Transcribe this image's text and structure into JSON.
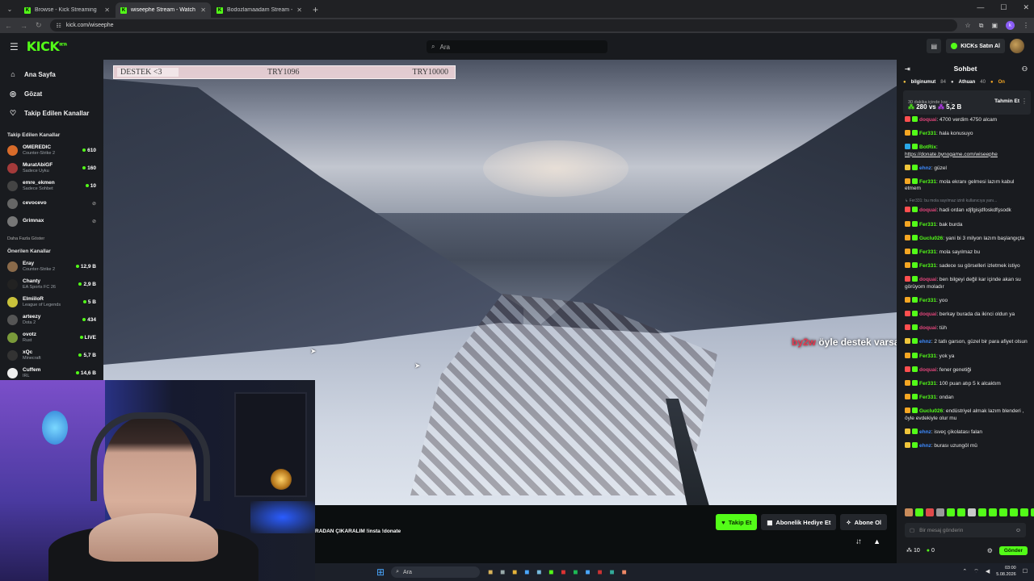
{
  "browser": {
    "tabs": [
      {
        "title": "Browse - Kick Streaming",
        "active": false
      },
      {
        "title": "wiseephe Stream - Watch Live o",
        "active": true
      },
      {
        "title": "Bodozlamaadam Stream - Watc",
        "active": false
      }
    ],
    "url": "kick.com/wiseephe"
  },
  "header": {
    "logo": "KICK",
    "logo_sup": "BETA",
    "search_placeholder": "Ara",
    "buy_kicks": "KICKs Satın Al"
  },
  "sidebar": {
    "nav": [
      {
        "icon": "home-icon",
        "glyph": "⌂",
        "label": "Ana Sayfa"
      },
      {
        "icon": "compass-icon",
        "glyph": "◎",
        "label": "Gözat"
      },
      {
        "icon": "heart-icon",
        "glyph": "♡",
        "label": "Takip Edilen Kanallar"
      }
    ],
    "followed_title": "Takip Edilen Kanallar",
    "followed": [
      {
        "name": "OMEREDIC",
        "game": "Counter-Strike 2",
        "viewers": "610",
        "color": "#d86b2a"
      },
      {
        "name": "MuratAbiGF",
        "game": "Sadece Uyku",
        "viewers": "160",
        "color": "#a33a3a"
      },
      {
        "name": "emre_ekmen",
        "game": "Sadece Sohbet",
        "viewers": "10",
        "color": "#444"
      },
      {
        "name": "cevocevo",
        "game": "",
        "viewers": "",
        "color": "#666"
      },
      {
        "name": "Grimnax",
        "game": "",
        "viewers": "",
        "color": "#777"
      }
    ],
    "more_label": "Daha Fazla Göster",
    "recommended_title": "Önerilen Kanallar",
    "recommended": [
      {
        "name": "Eray",
        "game": "Counter-Strike 2",
        "viewers": "12,9 B",
        "color": "#8a6a4a"
      },
      {
        "name": "Chanty",
        "game": "EA Sports FC 26",
        "viewers": "2,9 B",
        "color": "#222"
      },
      {
        "name": "ElmiiloR",
        "game": "League of Legends",
        "viewers": "5 B",
        "color": "#c9c23b"
      },
      {
        "name": "arteezy",
        "game": "Dota 2",
        "viewers": "434",
        "color": "#555"
      },
      {
        "name": "ovotz",
        "game": "Rust",
        "viewers": "LIVE",
        "color": "#7a9a3a"
      },
      {
        "name": "xQc",
        "game": "Minecraft",
        "viewers": "5,7 B",
        "color": "#333"
      },
      {
        "name": "Cuffem",
        "game": "IRL",
        "viewers": "14,6 B",
        "color": "#eee"
      }
    ]
  },
  "video": {
    "donation_label": "DESTEK <3",
    "donation_current": "TRY1096",
    "donation_goal": "TRY10000",
    "overlay_user": "by2w",
    "overlay_text": " öyle destek varsa o desteğin amk"
  },
  "below": {
    "stream_title": "RADAN ÇIKARALIM !insta !donate",
    "follow": "Takip Et",
    "gift": "Abonelik Hediye Et",
    "subscribe": "Abone Ol"
  },
  "chat": {
    "title": "Sohbet",
    "top": [
      {
        "name": "bilginumut",
        "count": "84"
      },
      {
        "name": "Athuan",
        "count": "40"
      },
      {
        "name": "On",
        "count": ""
      }
    ],
    "prediction_q": "30 dakika içinde kaç ...",
    "prediction_green": "280",
    "prediction_mid": " vs ",
    "prediction_purple": "5,2 B",
    "prediction_btn": "Tahmin Et",
    "messages": [
      {
        "user": "doquai",
        "ucolor": "#e0457a",
        "text": ": 4700 verdim 4750 alcam",
        "badge": "#ff4f4f"
      },
      {
        "user": "Fer331",
        "ucolor": "#53fc18",
        "text": ": hala konusuyo",
        "badge": "#f5a623"
      },
      {
        "user": "BotRix",
        "ucolor": "#53fc18",
        "text": ":",
        "badge": "#2aa7e8",
        "link": "https://donate.bynogame.com/wiseephe"
      },
      {
        "user": "ehnz",
        "ucolor": "#3e8bff",
        "text": ": güzel",
        "badge": "#f0c53b"
      },
      {
        "user": "Fer331",
        "ucolor": "#53fc18",
        "text": ": mola ekranı gelmesi lazım kabul etmem",
        "badge": "#f5a623"
      },
      {
        "user": "",
        "ucolor": "#777",
        "text": "↳ Fer331: bu mola sayılmaz izinli kullanıcıya yanı...",
        "badge": "",
        "small": true
      },
      {
        "user": "doquai",
        "ucolor": "#e0457a",
        "text": ": hadi ordan ıdjfgisjdfoskdfşsodk",
        "badge": "#ff4f4f"
      },
      {
        "user": "Fer331",
        "ucolor": "#53fc18",
        "text": ": bak burda",
        "badge": "#f5a623"
      },
      {
        "user": "Guclu026",
        "ucolor": "#53fc18",
        "text": ": yani bi 3 milyon lazım başlangıçta",
        "badge": "#f5a623"
      },
      {
        "user": "Fer331",
        "ucolor": "#53fc18",
        "text": ": mola sayılmaz bu",
        "badge": "#f5a623"
      },
      {
        "user": "Fer331",
        "ucolor": "#53fc18",
        "text": ": sadece su görselleri izletmek istiyo",
        "badge": "#f5a623"
      },
      {
        "user": "doquai",
        "ucolor": "#e0457a",
        "text": ": ben bilgeyi değil kar içinde akan su görüyom moladır",
        "badge": "#ff4f4f"
      },
      {
        "user": "Fer331",
        "ucolor": "#53fc18",
        "text": ": yoo",
        "badge": "#f5a623"
      },
      {
        "user": "doquai",
        "ucolor": "#e0457a",
        "text": ": berkay burada da ikinci oldun ya",
        "badge": "#ff4f4f"
      },
      {
        "user": "doquai",
        "ucolor": "#e0457a",
        "text": ": tüh",
        "badge": "#ff4f4f"
      },
      {
        "user": "ehnz",
        "ucolor": "#3e8bff",
        "text": ": 2 tatlı garson, güzel bir para afiyet olsun",
        "badge": "#f0c53b"
      },
      {
        "user": "Fer331",
        "ucolor": "#53fc18",
        "text": ": yok ya",
        "badge": "#f5a623"
      },
      {
        "user": "doquai",
        "ucolor": "#e0457a",
        "text": ": fener genetiği",
        "badge": "#ff4f4f"
      },
      {
        "user": "Fer331",
        "ucolor": "#53fc18",
        "text": ": 100 puan atıp 5 k alcaktım",
        "badge": "#f5a623"
      },
      {
        "user": "Fer331",
        "ucolor": "#53fc18",
        "text": ": ondan",
        "badge": "#f5a623"
      },
      {
        "user": "Guclu026",
        "ucolor": "#53fc18",
        "text": ": endüstriyel almak lazım blenderi , öyle evdekiyle olur mu",
        "badge": "#f5a623"
      },
      {
        "user": "ehnz",
        "ucolor": "#3e8bff",
        "text": ": isveç çikolatası falan",
        "badge": "#f0c53b"
      },
      {
        "user": "ehnz",
        "ucolor": "#3e8bff",
        "text": ": burası uzungöl mü",
        "badge": "#f0c53b"
      }
    ],
    "input_placeholder": "Bir mesaj gönderin",
    "points": "10",
    "kicks": "0",
    "send": "Gönder"
  },
  "taskbar": {
    "search": "Ara",
    "time": "03:00",
    "date": "5.08.2026"
  }
}
